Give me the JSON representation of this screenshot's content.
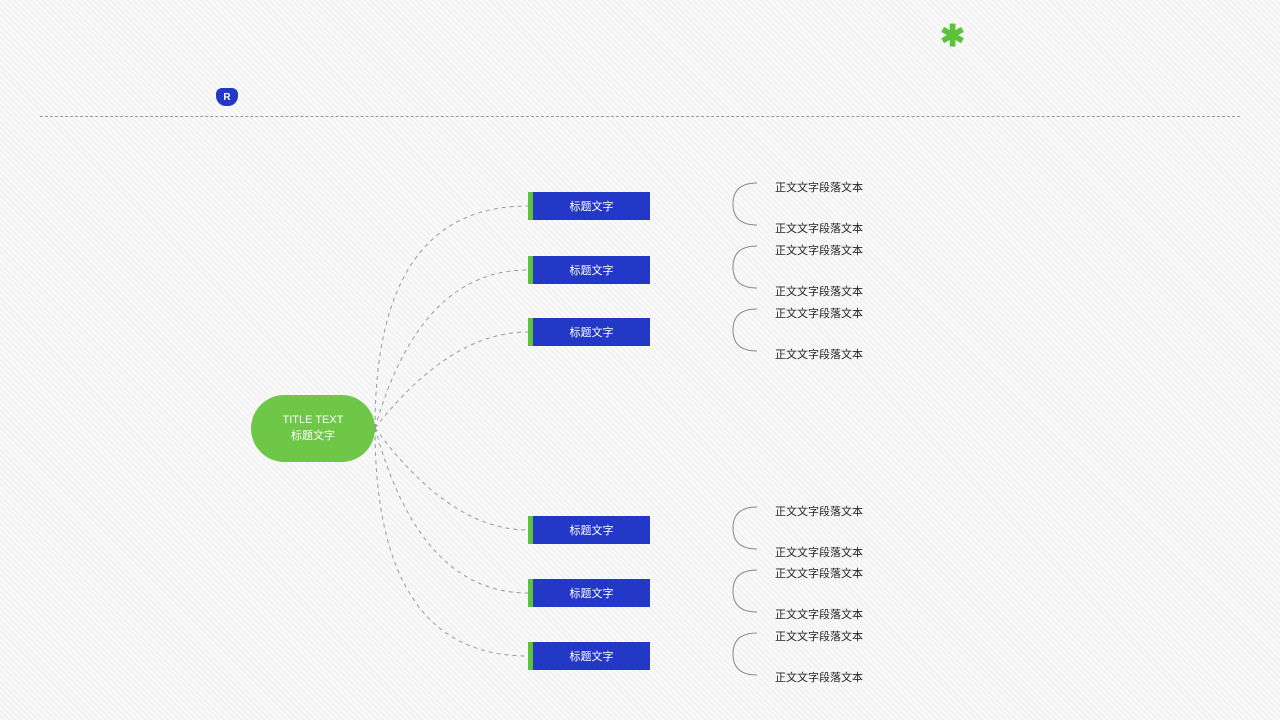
{
  "decor": {
    "badge_letter": "R",
    "asterisk": "✱"
  },
  "root": {
    "line1": "TITLE TEXT",
    "line2": "标题文字"
  },
  "branches": [
    {
      "title": "标题文字",
      "body1": "正文文字段落文本",
      "body2": "正文文字段落文本"
    },
    {
      "title": "标题文字",
      "body1": "正文文字段落文本",
      "body2": "正文文字段落文本"
    },
    {
      "title": "标题文字",
      "body1": "正文文字段落文本",
      "body2": "正文文字段落文本"
    },
    {
      "title": "标题文字",
      "body1": "正文文字段落文本",
      "body2": "正文文字段落文本"
    },
    {
      "title": "标题文字",
      "body1": "正文文字段落文本",
      "body2": "正文文字段落文本"
    },
    {
      "title": "标题文字",
      "body1": "正文文字段落文本",
      "body2": "正文文字段落文本"
    }
  ]
}
